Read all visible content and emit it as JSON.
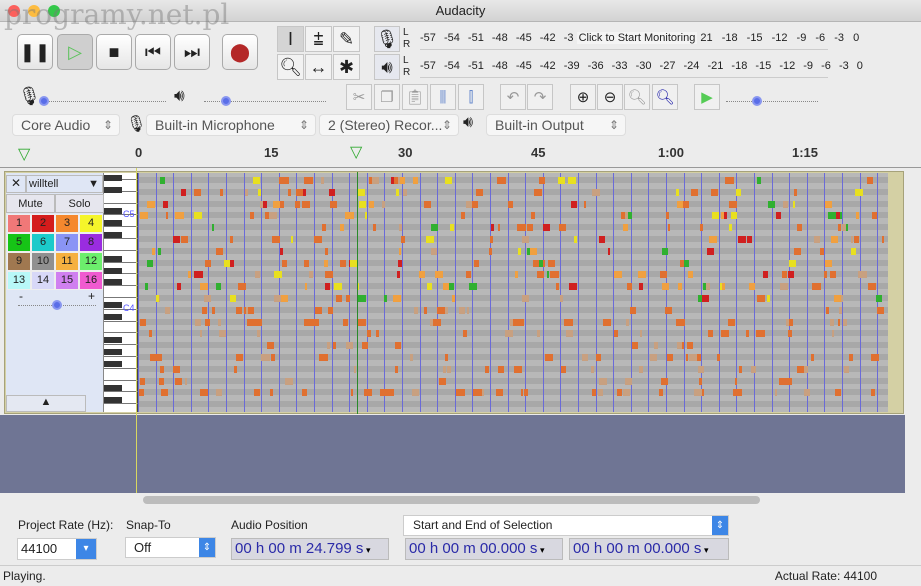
{
  "window": {
    "title": "Audacity"
  },
  "transport": {
    "buttons": [
      "pause",
      "play",
      "stop",
      "skip-to-start",
      "skip-to-end",
      "record"
    ]
  },
  "meters": {
    "record_scale": "-57 -54 -51 -48 -45 -42 -3",
    "record_prompt": "Click to Start Monitoring",
    "record_scale_end": "21 -18 -15 -12 -9 -6 -3 0",
    "playback_scale": "-57 -54 -51 -48 -45 -42 -39 -36 -33 -30 -27 -24 -21 -18 -15 -12 -9 -6 -3 0",
    "L": "L",
    "R": "R"
  },
  "devices": {
    "host": "Core Audio",
    "input": "Built-in Microphone",
    "channels": "2 (Stereo) Recor...",
    "output": "Built-in Output"
  },
  "ruler": {
    "labels": [
      "0",
      "15",
      "30",
      "45",
      "1:00",
      "1:15"
    ]
  },
  "track": {
    "name": "willtell",
    "mute": "Mute",
    "solo": "Solo",
    "channels": [
      "1",
      "2",
      "3",
      "4",
      "5",
      "6",
      "7",
      "8",
      "9",
      "10",
      "11",
      "12",
      "13",
      "14",
      "15",
      "16"
    ],
    "channel_colors": [
      "#f07878",
      "#d41c1c",
      "#f5882e",
      "#f5f52a",
      "#16c416",
      "#1ccaca",
      "#8a94f5",
      "#9a2ce0",
      "#a07850",
      "#909090",
      "#f5b040",
      "#6cee6c",
      "#b8f8f8",
      "#d8d8f8",
      "#d080f0",
      "#f05ad0"
    ],
    "note_labels": [
      "C5",
      "C4"
    ],
    "minus": "-",
    "plus": "+"
  },
  "selection_toolbar": {
    "project_rate_label": "Project Rate (Hz):",
    "project_rate": "44100",
    "snap_label": "Snap-To",
    "snap": "Off",
    "audio_position_label": "Audio Position",
    "audio_position": "00 h 00 m 24.799 s",
    "selection_mode": "Start and End of Selection",
    "sel_start": "00 h 00 m 00.000 s",
    "sel_end": "00 h 00 m 00.000 s"
  },
  "status": {
    "text": "Playing.",
    "rate": "Actual Rate: 44100"
  },
  "watermark": "programy.net.pl"
}
